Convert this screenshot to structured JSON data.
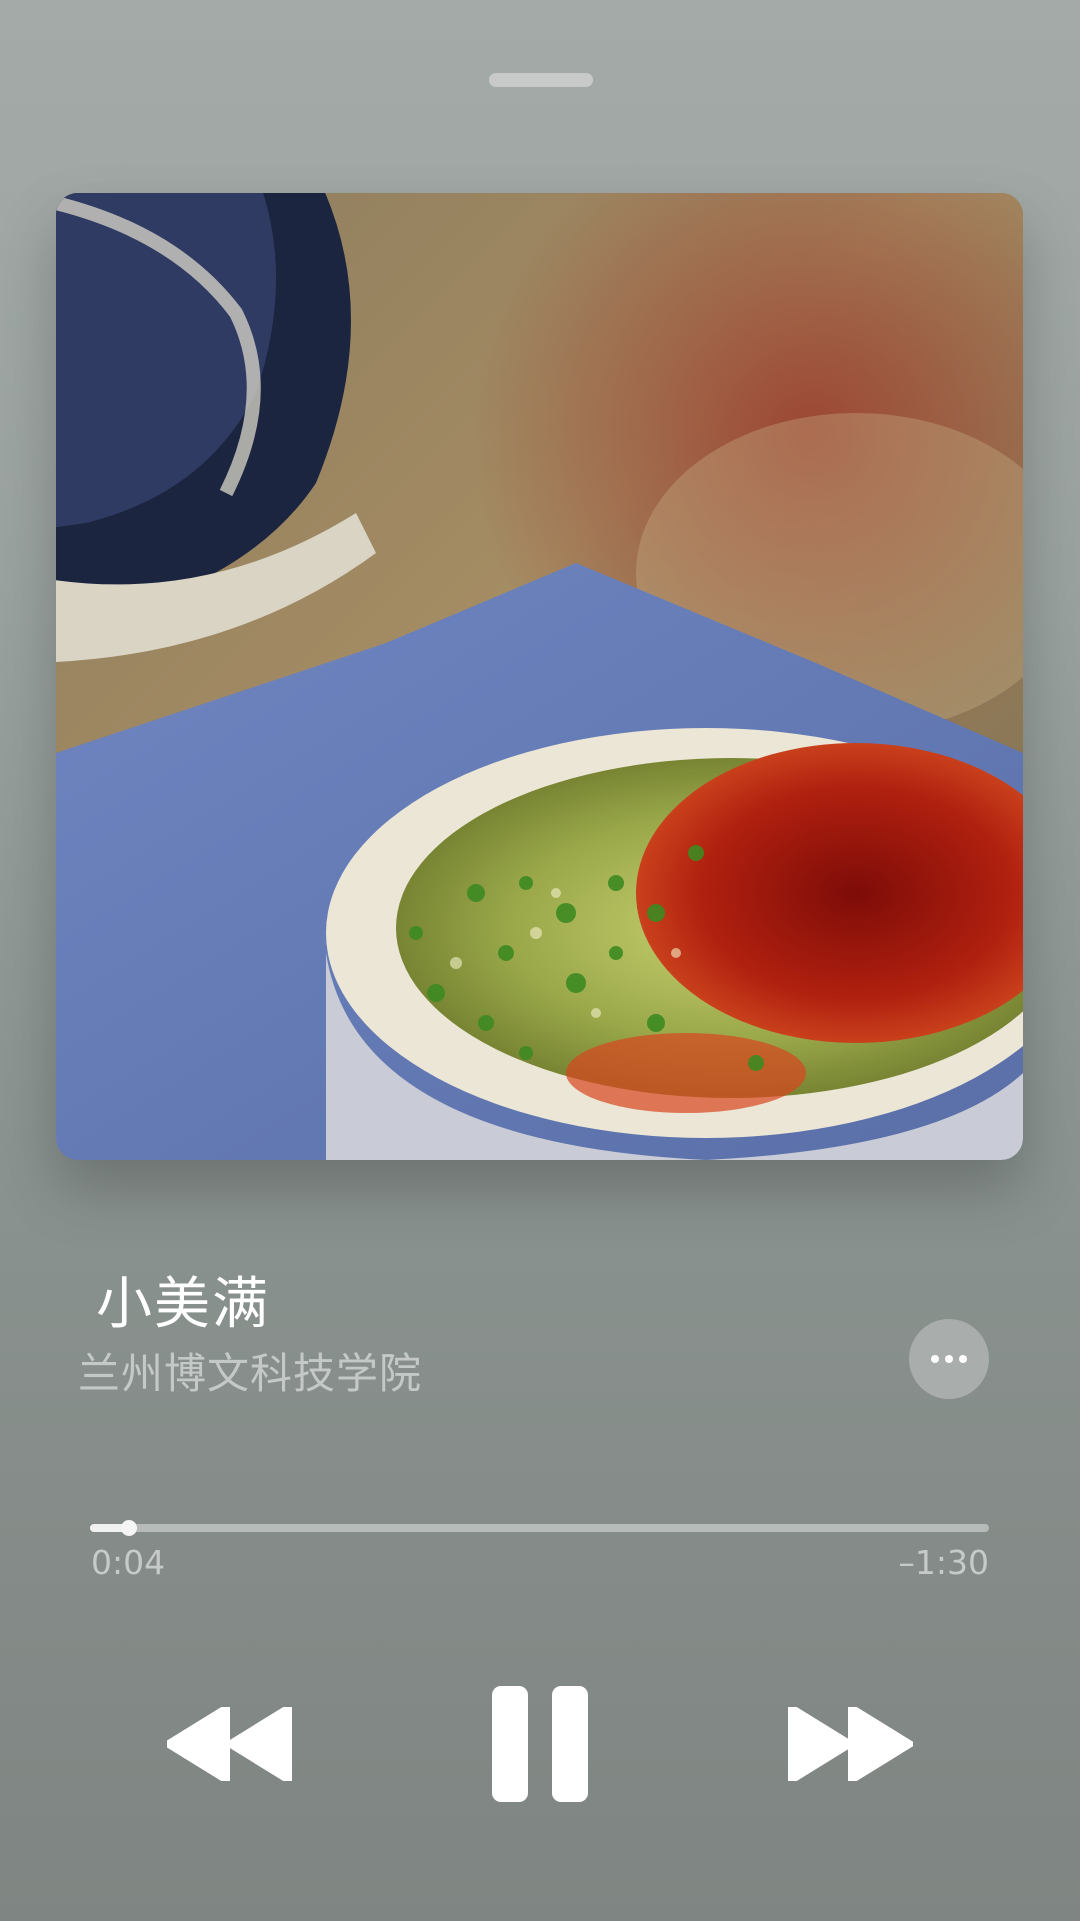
{
  "player": {
    "track_title": "小美满",
    "artist": "兰州博文科技学院",
    "progress": {
      "elapsed": "0:04",
      "remaining": "–1:30",
      "fraction": 0.043
    },
    "icons": {
      "more": "more-icon",
      "rewind": "rewind-icon",
      "pause": "pause-icon",
      "forward": "fast-forward-icon"
    },
    "colors": {
      "background": "#8f9794",
      "accent": "#ffffff"
    }
  }
}
